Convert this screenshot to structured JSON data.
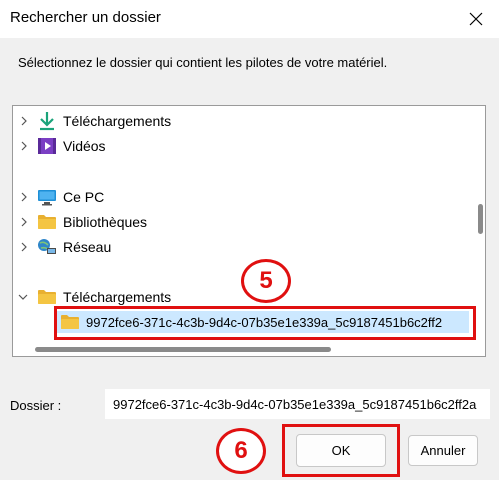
{
  "window": {
    "title": "Rechercher un dossier"
  },
  "instruction": "Sélectionnez le dossier qui contient les pilotes de votre matériel.",
  "tree": {
    "items": [
      {
        "label": "Téléchargements",
        "icon": "download-icon"
      },
      {
        "label": "Vidéos",
        "icon": "videos-icon"
      },
      {
        "label": "Ce PC",
        "icon": "computer-icon"
      },
      {
        "label": "Bibliothèques",
        "icon": "folder-icon"
      },
      {
        "label": "Réseau",
        "icon": "network-icon"
      },
      {
        "label": "Téléchargements",
        "icon": "folder-icon",
        "expanded": true
      },
      {
        "label": "9972fce6-371c-4c3b-9d4c-07b35e1e339a_5c9187451b6c2ff2",
        "icon": "folder-icon",
        "selected": true
      }
    ]
  },
  "folder": {
    "label": "Dossier :",
    "value": "9972fce6-371c-4c3b-9d4c-07b35e1e339a_5c9187451b6c2ff2a"
  },
  "buttons": {
    "ok": "OK",
    "cancel": "Annuler"
  },
  "annotations": {
    "step5": "5",
    "step6": "6"
  },
  "colors": {
    "annotation": "#e01010",
    "selection": "#cce8ff",
    "folder": "#f4c542"
  }
}
